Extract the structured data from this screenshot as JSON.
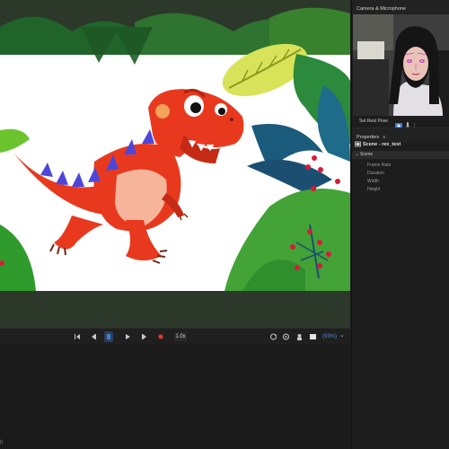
{
  "camera_panel": {
    "title": "Camera & Microphone",
    "set_rest_pose": "Set Rest Pose"
  },
  "properties_panel": {
    "title": "Properties",
    "menu_icon": "hamburger-icon",
    "scene_name": "Scene - rex_test",
    "section": "Scene",
    "fields": [
      "Frame Rate",
      "Duration",
      "Width",
      "Height"
    ]
  },
  "transport": {
    "rate": "1.0x",
    "zoom": "(93%)"
  },
  "colors": {
    "accent": "#3b82d6",
    "record": "#e23b2e",
    "dino_body": "#e8391f",
    "dino_belly": "#f6b59b",
    "dino_stripes": "#4d47d8"
  }
}
